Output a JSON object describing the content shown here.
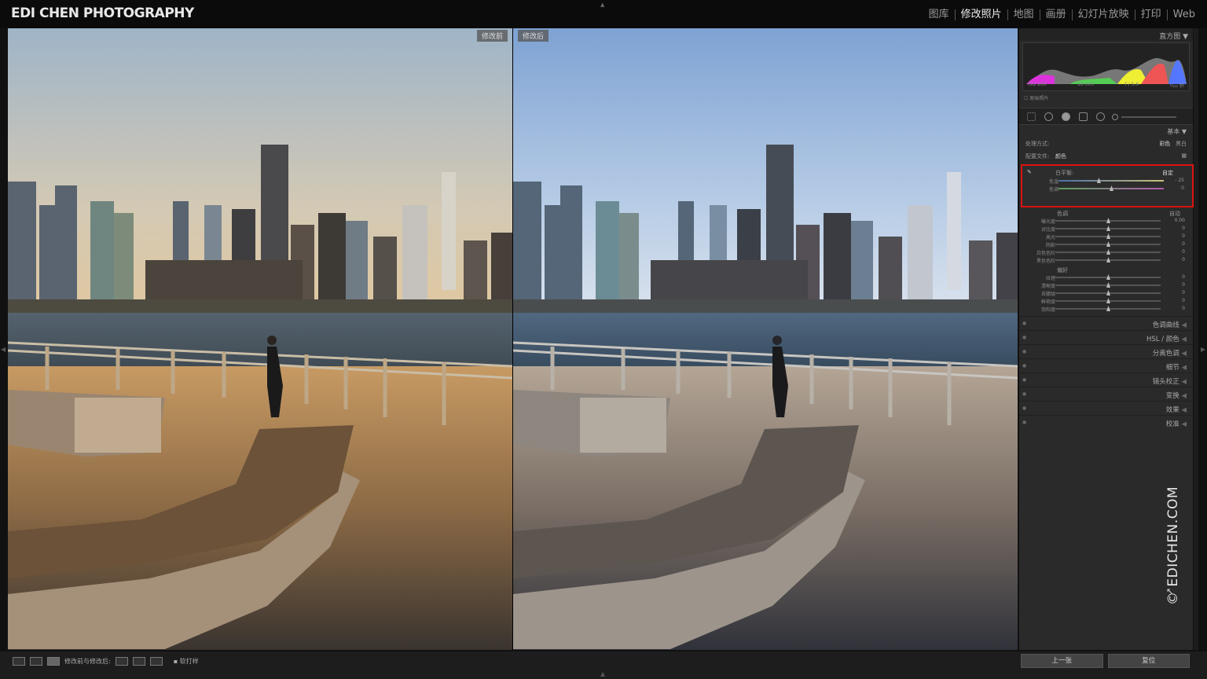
{
  "app": {
    "brand": "EDI CHEN PHOTOGRAPHY",
    "modules": [
      "图库",
      "修改照片",
      "地图",
      "画册",
      "幻灯片放映",
      "打印",
      "Web"
    ],
    "active_module": "修改照片"
  },
  "viewer": {
    "before_label": "修改前",
    "after_label": "修改后"
  },
  "panel": {
    "histogram_title": "直方图",
    "exif": {
      "iso": "ISO 200",
      "focal": "16 mm",
      "aperture": "f / 5.6",
      "shutter": "¹⁄₁₆₀ 秒"
    },
    "original_photo_label": "原始照片",
    "basic_title": "基本",
    "treatment": {
      "label": "处理方式:",
      "color": "彩色",
      "bw": "黑白"
    },
    "profile": {
      "label": "配置文件:",
      "value": "颜色"
    },
    "white_balance": {
      "label": "白平衡:",
      "value": "自定",
      "sliders": [
        {
          "label": "色温",
          "value": "- 25",
          "pos": 0.38
        },
        {
          "label": "色调",
          "value": "0",
          "pos": 0.5
        }
      ]
    },
    "tone": {
      "label": "色调",
      "auto": "自动",
      "sliders": [
        {
          "label": "曝光度",
          "value": "0.00",
          "pos": 0.5
        },
        {
          "label": "对比度",
          "value": "0",
          "pos": 0.5
        },
        {
          "label": "高光",
          "value": "0",
          "pos": 0.5
        },
        {
          "label": "阴影",
          "value": "0",
          "pos": 0.5
        },
        {
          "label": "白色色阶",
          "value": "0",
          "pos": 0.5
        },
        {
          "label": "黑色色阶",
          "value": "0",
          "pos": 0.5
        }
      ]
    },
    "presence": {
      "label": "偏好",
      "sliders": [
        {
          "label": "纹理",
          "value": "0",
          "pos": 0.5
        },
        {
          "label": "清晰度",
          "value": "0",
          "pos": 0.5
        },
        {
          "label": "去朦胧",
          "value": "0",
          "pos": 0.5
        },
        {
          "label": "鲜艳度",
          "value": "0",
          "pos": 0.5
        },
        {
          "label": "饱和度",
          "value": "0",
          "pos": 0.5
        }
      ]
    },
    "collapsed_sections": [
      "色调曲线",
      "HSL / 颜色",
      "分离色调",
      "细节",
      "镜头校正",
      "变换",
      "效果",
      "校准"
    ]
  },
  "toolbar": {
    "before_after_label": "修改前与修改后:",
    "soft_proof_label": "软打样"
  },
  "panel_buttons": {
    "previous": "上一张",
    "reset": "复位"
  },
  "watermark": "© EDICHEN.COM"
}
